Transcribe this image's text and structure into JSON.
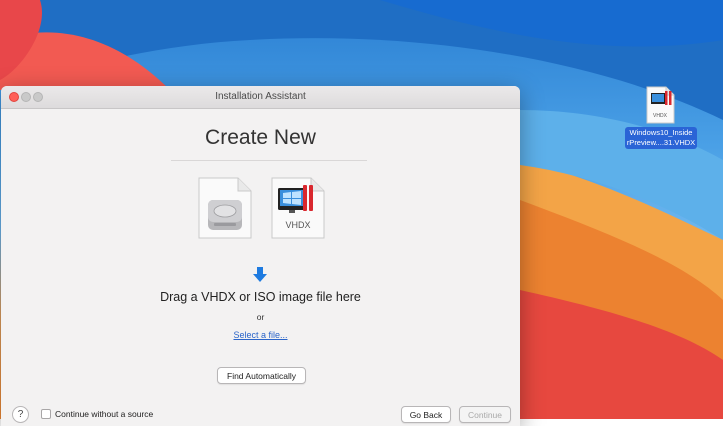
{
  "window": {
    "title": "Installation Assistant",
    "heading": "Create New",
    "vhdx_icon_label": "VHDX",
    "drag_text": "Drag a VHDX or ISO image file here",
    "or_text": "or",
    "select_link": "Select a file...",
    "find_button": "Find Automatically",
    "help_label": "?",
    "checkbox_label": "Continue without a source",
    "back_button": "Go Back",
    "continue_button": "Continue"
  },
  "desktop": {
    "file_label_line1": "Windows10_Inside",
    "file_label_line2": "rPreview....31.VHDX",
    "file_icon_badge": "VHDX"
  },
  "colors": {
    "accent_blue": "#2b65c9",
    "selection_blue": "#2a64d6",
    "close_red": "#ff5f57",
    "parallels_red": "#d9282f"
  },
  "icons": [
    "disk-image-icon",
    "vhdx-file-icon",
    "down-arrow-icon",
    "vhdx-desktop-file-icon"
  ]
}
